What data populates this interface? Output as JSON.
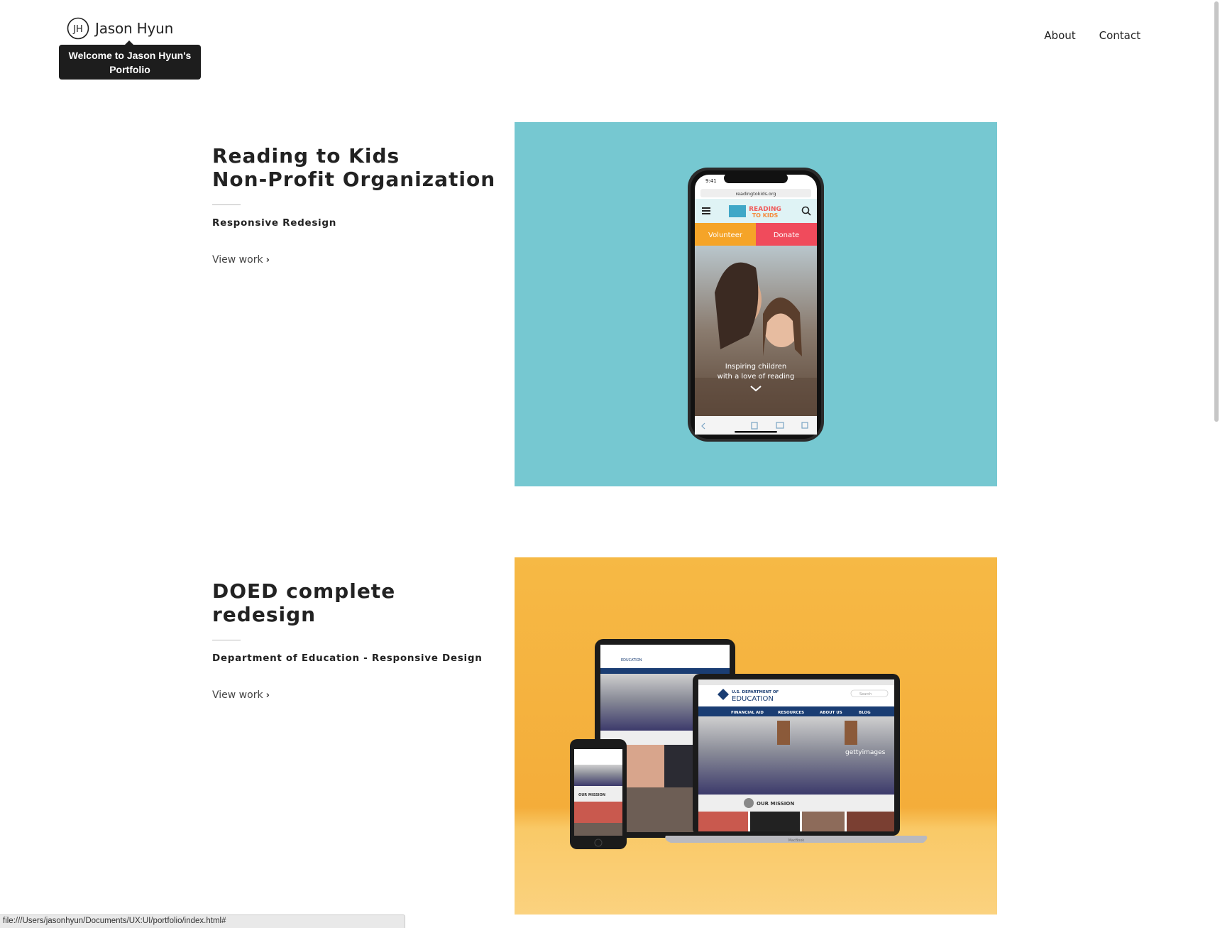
{
  "header": {
    "brand_name": "Jason Hyun",
    "logo_text": "JH",
    "tooltip": "Welcome to Jason Hyun's Portfolio",
    "nav": [
      {
        "label": "About"
      },
      {
        "label": "Contact"
      }
    ]
  },
  "projects": [
    {
      "title": "Reading to Kids\nNon-Profit Organization",
      "subtitle": "Responsive Redesign",
      "link_label": "View work",
      "background_color": "#76c8d1",
      "mockup": {
        "time": "9:41",
        "url": "readingtokids.org",
        "logo_line1": "READING",
        "logo_line2": "TO KIDS",
        "volunteer_label": "Volunteer",
        "donate_label": "Donate",
        "tagline_line1": "Inspiring children",
        "tagline_line2": "with a love of reading"
      }
    },
    {
      "title": "DOED complete\nredesign",
      "subtitle": "Department of Education - Responsive Design",
      "link_label": "View work",
      "background_color": "#f4b13f",
      "mockup": {
        "org_small": "U.S. DEPARTMENT OF",
        "org_large": "EDUCATION",
        "nav_items": [
          "FINANCIAL AID",
          "RESOURCES",
          "ABOUT US",
          "BLOG"
        ],
        "mission_label": "OUR MISSION",
        "search_placeholder": "Search",
        "watermark": "gettyimages",
        "laptop_label": "MacBook"
      }
    }
  ],
  "status_url": "file:///Users/jasonhyun/Documents/UX:UI/portfolio/index.html#"
}
